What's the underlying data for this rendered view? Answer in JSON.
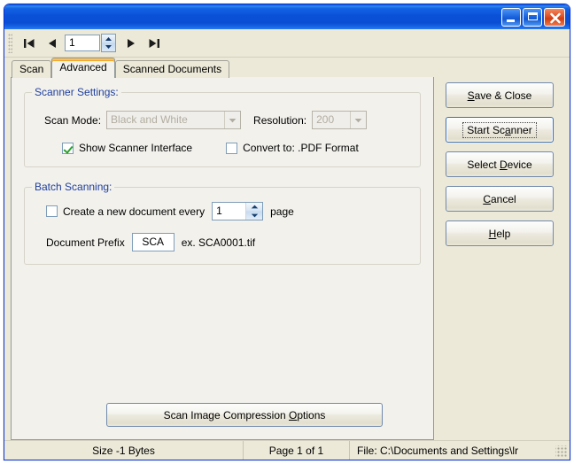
{
  "window": {
    "title": "",
    "controls": {
      "minimize": "Minimize",
      "maximize": "Maximize",
      "close": "Close"
    }
  },
  "navbar": {
    "first_label": "First record",
    "prev_label": "Previous record",
    "page_value": "1",
    "next_label": "Next record",
    "last_label": "Last record"
  },
  "tabs": [
    {
      "label": "Scan",
      "active": false
    },
    {
      "label": "Advanced",
      "active": true
    },
    {
      "label": "Scanned Documents",
      "active": false
    }
  ],
  "scanner_settings": {
    "legend": "Scanner Settings:",
    "scan_mode_label": "Scan Mode:",
    "scan_mode_value": "Black and White",
    "resolution_label": "Resolution:",
    "resolution_value": "200",
    "show_interface_label": "Show Scanner Interface",
    "show_interface_checked": true,
    "convert_label": "Convert to: .PDF Format",
    "convert_checked": false
  },
  "batch_scanning": {
    "legend": "Batch Scanning:",
    "create_new_doc_label": "Create a new document every",
    "create_new_doc_checked": false,
    "every_value": "1",
    "page_unit_label": "page",
    "prefix_label": "Document Prefix",
    "prefix_value": "SCA",
    "prefix_example": "ex. SCA0001.tif"
  },
  "compression_button": {
    "text_before": "Scan Image Compression ",
    "accel": "O",
    "text_after": "ptions"
  },
  "side_buttons": [
    {
      "name": "save-close",
      "before": "",
      "accel": "S",
      "after": "ave & Close",
      "focused": false
    },
    {
      "name": "start-scanner",
      "before": "Start Sc",
      "accel": "a",
      "after": "nner",
      "focused": true
    },
    {
      "name": "select-device",
      "before": "Select ",
      "accel": "D",
      "after": "evice",
      "focused": false
    },
    {
      "name": "cancel",
      "before": "",
      "accel": "C",
      "after": "ancel",
      "focused": false
    },
    {
      "name": "help",
      "before": "",
      "accel": "H",
      "after": "elp",
      "focused": false
    }
  ],
  "statusbar": {
    "size": "Size -1 Bytes",
    "page": "Page 1 of 1",
    "file": "File: C:\\Documents and Settings\\lr"
  },
  "colors": {
    "titlebar_blue": "#0a51d8",
    "dialog_face": "#ece9d8",
    "tabpage_face": "#f2f1ec",
    "group_label": "#1f3f9e",
    "check_green": "#2aa02a",
    "tab_highlight": "#f5a623",
    "close_red": "#cf3d12"
  }
}
